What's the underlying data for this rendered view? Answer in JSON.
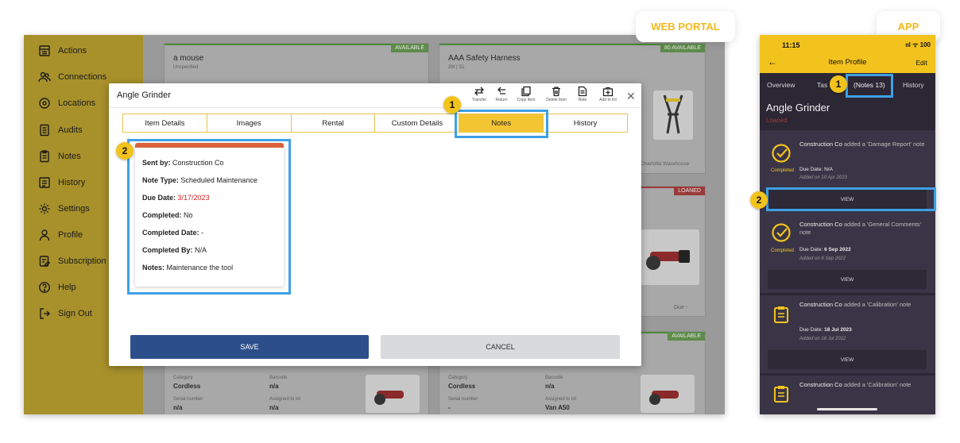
{
  "labels": {
    "web_portal": "WEB PORTAL",
    "app": "APP"
  },
  "callouts": [
    "1",
    "2"
  ],
  "sidebar": {
    "items": [
      {
        "label": "Actions",
        "icon": "actions-icon"
      },
      {
        "label": "Connections",
        "icon": "connections-icon"
      },
      {
        "label": "Locations",
        "icon": "location-pin-icon"
      },
      {
        "label": "Audits",
        "icon": "audits-icon"
      },
      {
        "label": "Notes",
        "icon": "notes-icon"
      },
      {
        "label": "History",
        "icon": "history-icon"
      },
      {
        "label": "Settings",
        "icon": "gear-icon"
      },
      {
        "label": "Profile",
        "icon": "profile-icon"
      },
      {
        "label": "Subscription",
        "icon": "subscription-icon"
      },
      {
        "label": "Help",
        "icon": "help-icon"
      },
      {
        "label": "Sign Out",
        "icon": "sign-out-icon"
      }
    ]
  },
  "background": {
    "card1": {
      "title": "a mouse",
      "sub": "Unspecified",
      "badge": "AVAILABLE"
    },
    "card2": {
      "title": "AAA Safety Harness",
      "sub": "3M | S1",
      "badge": "80 AVAILABLE",
      "location": "Charlotte Warehouse"
    },
    "card3": {
      "badge": "LOANED",
      "due": "Due -"
    },
    "card4": {
      "badge": "AVAILABLE"
    },
    "bottom_left": {
      "category_label": "Category",
      "category": "Cordless",
      "barcode_label": "Barcode",
      "barcode": "n/a",
      "serial_label": "Serial number",
      "serial": "n/a",
      "kit_label": "Assigned to kit",
      "kit": "n/a"
    },
    "bottom_right": {
      "category_label": "Category",
      "category": "Cordless",
      "barcode_label": "Barcode",
      "barcode": "n/a",
      "serial_label": "Serial number",
      "serial": "-",
      "kit_label": "Assigned to kit",
      "kit": "Van A50"
    }
  },
  "modal": {
    "title": "Angle Grinder",
    "toolbar": [
      "Transfer",
      "Return",
      "Copy Item",
      "Delete Item",
      "Note",
      "Add to Kit"
    ],
    "tabs": [
      "Item Details",
      "Images",
      "Rental",
      "Custom Details",
      "Notes",
      "History"
    ],
    "active_tab": "Notes",
    "note": {
      "sent_by_label": "Sent by:",
      "sent_by": "Construction Co",
      "type_label": "Note Type:",
      "type": "Scheduled Maintenance",
      "due_label": "Due Date:",
      "due": "3/17/2023",
      "completed_label": "Completed:",
      "completed": "No",
      "completed_date_label": "Completed Date:",
      "completed_date": "-",
      "completed_by_label": "Completed By:",
      "completed_by": "N/A",
      "notes_label": "Notes:",
      "notes": "Maintenance the tool"
    },
    "save": "SAVE",
    "cancel": "CANCEL"
  },
  "app": {
    "time": "11:15",
    "status": "ııl ᯤ 100",
    "title": "Item Profile",
    "edit": "Edit",
    "tabs": {
      "overview": "Overview",
      "tasks": "Tas",
      "notes": "(Notes 13)",
      "history": "History"
    },
    "item_name": "Angle Grinder",
    "item_status": "Loaned",
    "entries": [
      {
        "author": "Construction Co",
        "text": " added a 'Damage Report' note",
        "status": "Completed",
        "due_label": "Due Date:",
        "due": "N/A",
        "added": "Added on 10 Apr 2023",
        "view": "VIEW"
      },
      {
        "author": "Construction Co",
        "text": " added a 'General Comments' note",
        "status": "Completed",
        "due_label": "Due Date:",
        "due": "6 Sep 2022",
        "added": "Added on 6 Sep 2022",
        "view": "VIEW"
      },
      {
        "author": "Construction Co",
        "text": " added a 'Calibration' note",
        "due_label": "Due Date:",
        "due": "18 Jul 2023",
        "added": "Added on 18 Jul 2022",
        "view": "VIEW"
      },
      {
        "author": "Construction Co",
        "text": " added a 'Calibration' note"
      }
    ]
  },
  "colors": {
    "accent": "#f3c31d",
    "highlight": "#3ea0e6",
    "save": "#2c4f8c",
    "loaned": "#a03a3a"
  }
}
